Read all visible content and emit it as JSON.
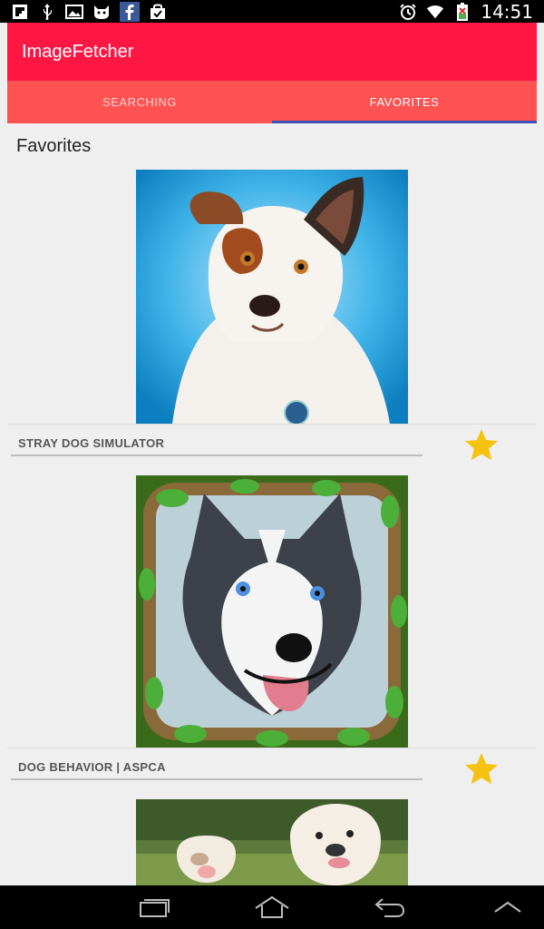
{
  "status_bar": {
    "time": "14:51",
    "left_icons": [
      "flipboard-icon",
      "usb-icon",
      "image-icon",
      "cat-icon",
      "facebook-icon",
      "shopping-bag-icon"
    ],
    "right_icons": [
      "alarm-icon",
      "wifi-icon",
      "battery-icon"
    ]
  },
  "app": {
    "title": "ImageFetcher",
    "bar_color": "#ff1744",
    "tab_color": "#ff5252",
    "indicator_color": "#3f51b5"
  },
  "tabs": [
    {
      "label": "SEARCHING",
      "selected": false
    },
    {
      "label": "FAVORITES",
      "selected": true
    }
  ],
  "favorites": {
    "title": "Favorites",
    "items": [
      {
        "caption": "STRAY DOG SIMULATOR",
        "favorited": true,
        "image": "dog-portrait-image"
      },
      {
        "caption": "DOG BEHAVIOR | ASPCA",
        "favorited": true,
        "image": "husky-portrait-image"
      },
      {
        "caption": "",
        "favorited": true,
        "image": "bulldogs-image"
      }
    ]
  },
  "nav_bar": {
    "buttons": [
      "recent-apps-icon",
      "home-icon",
      "back-icon",
      "up-arrow-icon"
    ]
  }
}
